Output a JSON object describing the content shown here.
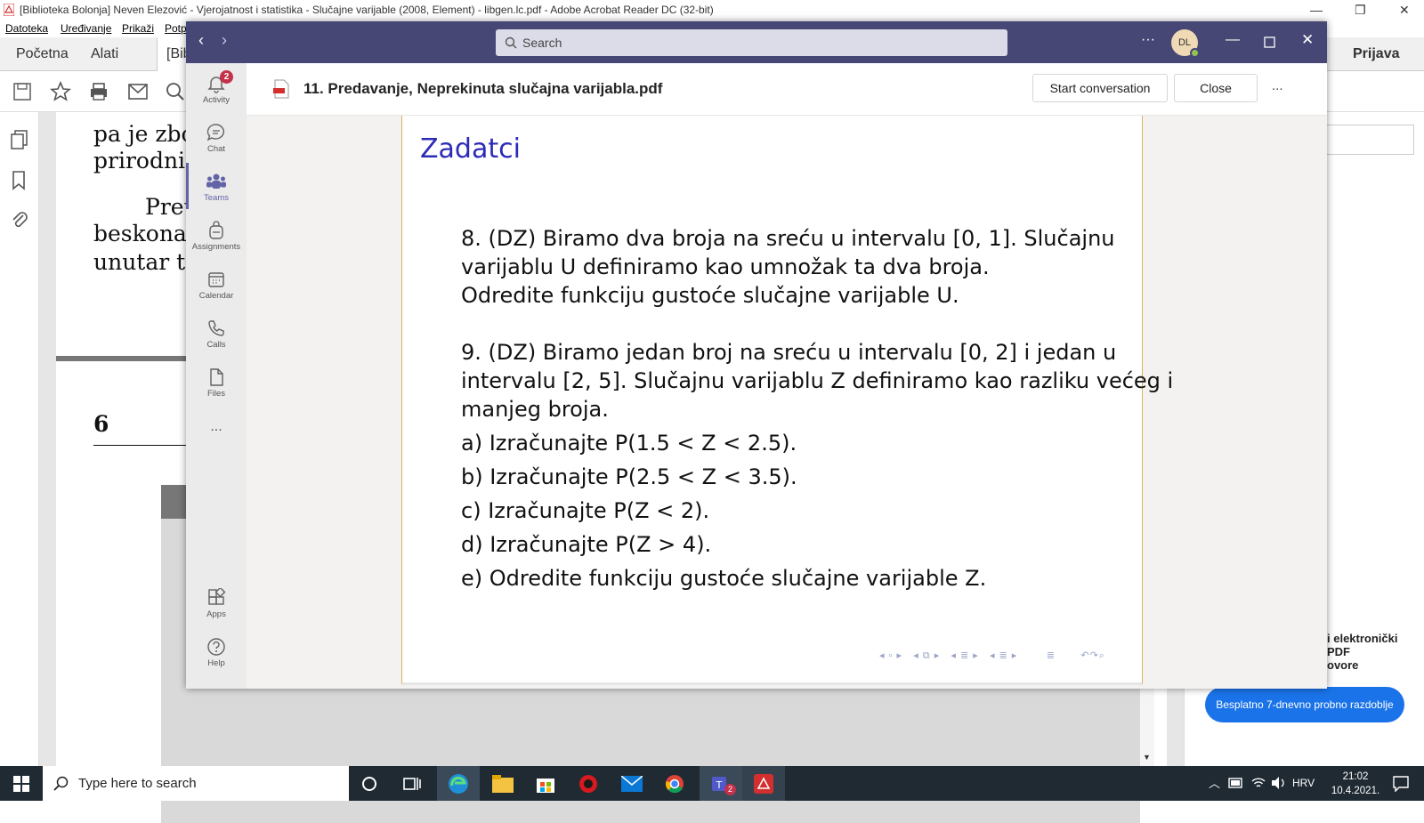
{
  "acrobat": {
    "title": "[Biblioteka Bolonja] Neven Elezović - Vjerojatnost i statistika - Slučajne varijable (2008, Element) - libgen.lc.pdf - Adobe Acrobat Reader DC (32-bit)",
    "menu": [
      "Datoteka",
      "Uređivanje",
      "Prikaži",
      "Potp"
    ],
    "tabs": {
      "home": "Početna",
      "tools": "Alati",
      "doc": "[Bib",
      "signin": "Prijava"
    },
    "page_lines": [
      "pa je zbog",
      "prirodnih",
      "Pret",
      "beskonač",
      "unutar to"
    ],
    "page_number": "6",
    "right_panel_lines": [
      "i elektronički",
      "PDF",
      "ovore"
    ],
    "trial_button": "Besplatno 7-dnevno probno razdoblje"
  },
  "teams": {
    "search_placeholder": "Search",
    "avatar_initials": "DL",
    "rail": [
      {
        "label": "Activity",
        "icon": "bell-icon",
        "badge": "2"
      },
      {
        "label": "Chat",
        "icon": "chat-icon"
      },
      {
        "label": "Teams",
        "icon": "teams-icon"
      },
      {
        "label": "Assignments",
        "icon": "backpack-icon"
      },
      {
        "label": "Calendar",
        "icon": "calendar-icon"
      },
      {
        "label": "Calls",
        "icon": "phone-icon"
      },
      {
        "label": "Files",
        "icon": "file-icon"
      }
    ],
    "more": "...",
    "apps": "Apps",
    "help": "Help",
    "file_title": "11. Predavanje, Neprekinuta slučajna varijabla.pdf",
    "start_conversation": "Start conversation",
    "close": "Close",
    "more_options": "..."
  },
  "slide": {
    "title": "Zadatci",
    "lines": [
      "8. (DZ) Biramo dva broja na sreću u intervalu [0, 1]. Slučajnu",
      "varijablu U definiramo kao umnožak ta dva broja.",
      "Odredite funkciju gustoće slučajne varijable U.",
      "9. (DZ) Biramo jedan broj na sreću u intervalu [0, 2] i jedan u",
      "intervalu [2, 5]. Slučajnu varijablu Z definiramo kao razliku većeg i",
      "manjeg broja.",
      "a) Izračunajte P(1.5 < Z < 2.5).",
      "b) Izračunajte P(2.5 < Z < 3.5).",
      "c) Izračunajte P(Z < 2).",
      "d) Izračunajte P(Z > 4).",
      "e) Odredite funkciju gustoće slučajne varijable Z."
    ]
  },
  "taskbar": {
    "search_placeholder": "Type here to search",
    "language": "HRV",
    "time": "21:02",
    "date": "10.4.2021.",
    "teams_badge": "2"
  },
  "colors": {
    "teams_purple": "#464775",
    "slide_title_blue": "#2b2bb8",
    "trial_blue": "#1a73e8"
  }
}
